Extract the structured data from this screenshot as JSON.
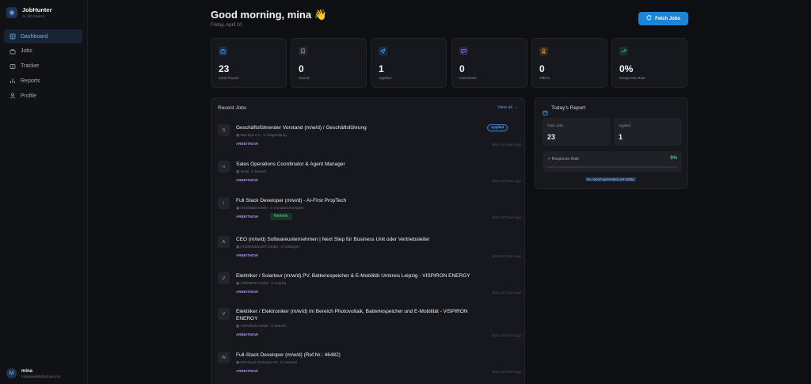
{
  "app": {
    "title": "JobHunter",
    "subtitle": "AI Job Search"
  },
  "nav": [
    {
      "label": "Dashboard",
      "icon": "dashboard-icon",
      "active": true
    },
    {
      "label": "Jobs",
      "icon": "briefcase-icon",
      "active": false
    },
    {
      "label": "Tracker",
      "icon": "board-icon",
      "active": false
    },
    {
      "label": "Reports",
      "icon": "bar-chart-icon",
      "active": false
    },
    {
      "label": "Profile",
      "icon": "user-icon",
      "active": false
    }
  ],
  "user": {
    "initial": "M",
    "name": "mina",
    "email": "minasaad88@gmail.com"
  },
  "header": {
    "greeting": "Good morning, mina 👋",
    "date": "Friday, April 10",
    "fetch_label": "Fetch Jobs"
  },
  "stats": [
    {
      "value": "23",
      "label": "Jobs Found",
      "icon": "briefcase-icon",
      "color": "#5aa6ec",
      "bg": "#17304d"
    },
    {
      "value": "0",
      "label": "Saved",
      "icon": "bookmark-icon",
      "color": "#9aa0ad",
      "bg": "#262830"
    },
    {
      "value": "1",
      "label": "Applied",
      "icon": "send-icon",
      "color": "#5aa6ec",
      "bg": "#17304d"
    },
    {
      "value": "0",
      "label": "Interviews",
      "icon": "chat-icon",
      "color": "#b48cf5",
      "bg": "#2c2346"
    },
    {
      "value": "0",
      "label": "Offers",
      "icon": "award-icon",
      "color": "#f0a742",
      "bg": "#3a2c16"
    },
    {
      "value": "0%",
      "label": "Response Rate",
      "icon": "trending-up-icon",
      "color": "#4cc78c",
      "bg": "#16332a"
    }
  ],
  "recent_jobs": {
    "title": "Recent Jobs",
    "view_all": "View all →",
    "items": [
      {
        "initial": "S",
        "title": "Geschäftsführender Vorstand (m/w/d) / Geschäftsführung",
        "company": "See-Eye e.V.",
        "location": "Regensburg",
        "source": "ARBEITNOW",
        "time": "about 10 hours ago",
        "status": "Applied",
        "tag": ""
      },
      {
        "initial": "n",
        "title": "Sales Operations Coordinator & Agent Manager",
        "company": "nevel",
        "location": "Munich",
        "source": "ARBEITNOW",
        "time": "about 10 hours ago",
        "status": "",
        "tag": ""
      },
      {
        "initial": "i",
        "title": "Full Stack Developer (m/w/d) - AI-First PropTech",
        "company": "immobalia GmbH",
        "location": "Konstanz/Kempten",
        "source": "ARBEITNOW",
        "time": "about 10 hours ago",
        "status": "",
        "tag": "Remote"
      },
      {
        "initial": "A",
        "title": "CEO (m/w/d) Softwareunternehmen | Next Step für Business Unit oder Vertriebsleiter",
        "company": "AYGENSEILERT GmbH",
        "location": "Göttingen",
        "source": "ARBEITNOW",
        "time": "about 10 hours ago",
        "status": "",
        "tag": ""
      },
      {
        "initial": "V",
        "title": "Elektriker / Solarteur (m/w/d) PV, Batteriespeicher & E-Mobilität Umkreis Leipzig - VISPIRON ENERGY",
        "company": "VISPIRON GmbH",
        "location": "Leipzig",
        "source": "ARBEITNOW",
        "time": "about 10 hours ago",
        "status": "",
        "tag": ""
      },
      {
        "initial": "V",
        "title": "Elektriker / Elektroniker (m/w/d) im Bereich Photovoltaik, Batteriespeicher und E-Mobilität - VISPIRON ENERGY",
        "company": "VISPIRON GmbH",
        "location": "Munich",
        "source": "ARBEITNOW",
        "time": "about 10 hours ago",
        "status": "",
        "tag": ""
      },
      {
        "initial": "W",
        "title": "Full-Stack Developer (m/w/d) (Ref.Nr.: 46482)",
        "company": "Wirecloud Germany AG",
        "location": "Hanover",
        "source": "ARBEITNOW",
        "time": "about 10 hours ago",
        "status": "",
        "tag": ""
      }
    ]
  },
  "report": {
    "title": "Today's Report",
    "total_label": "Total Jobs",
    "total_value": "23",
    "applied_label": "Applied",
    "applied_value": "1",
    "rate_label": "Response Rate",
    "rate_value": "0%",
    "rate_fraction": 0,
    "link": "No report generated yet today"
  }
}
